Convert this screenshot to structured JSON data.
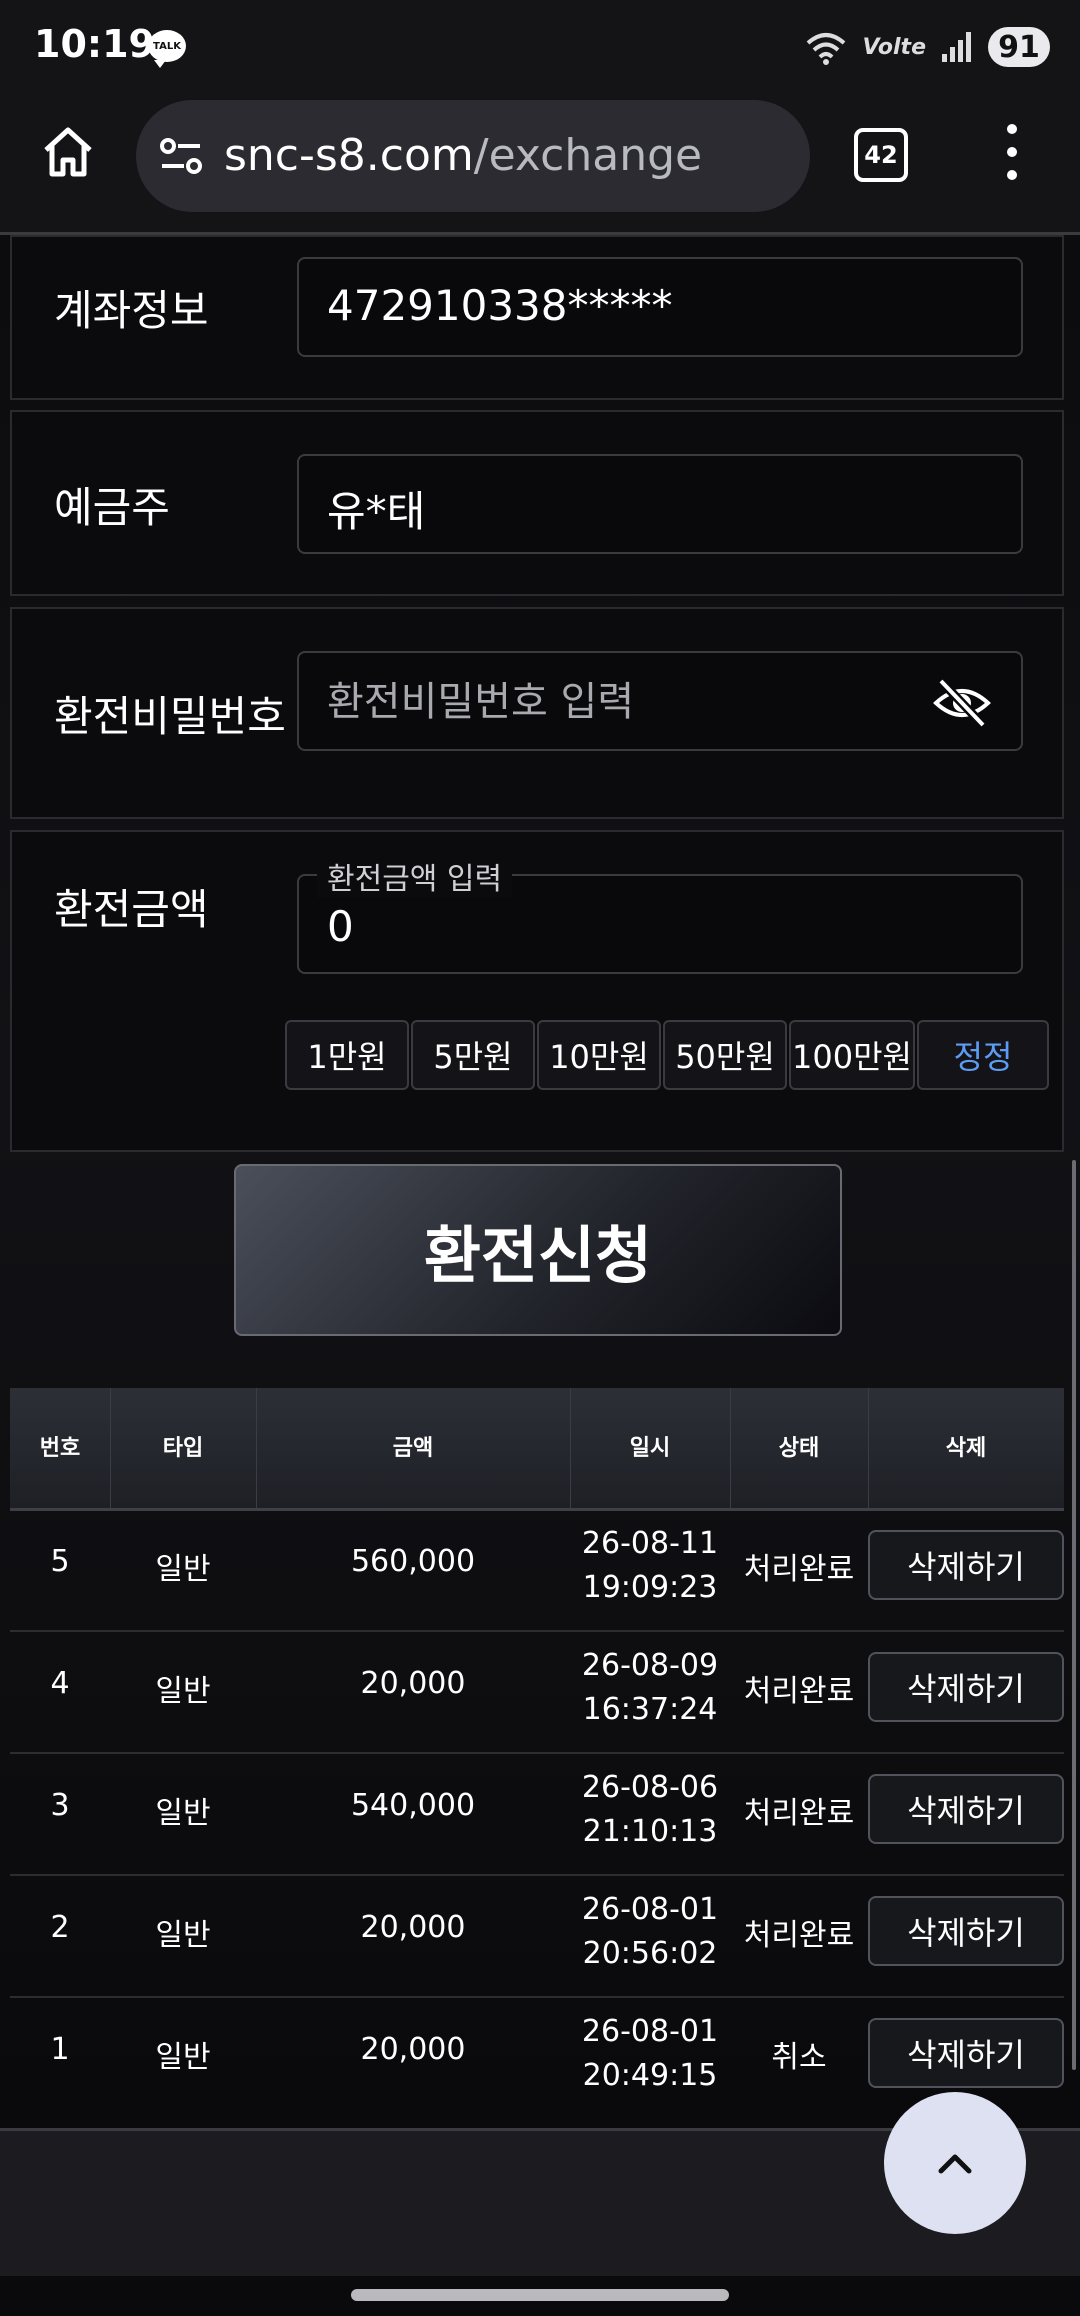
{
  "status_bar": {
    "time": "10:19",
    "talk_badge": "TALK",
    "network": "Volte",
    "battery": "91"
  },
  "browser": {
    "url_domain": "snc-s8.com",
    "url_path": "/exchange",
    "tab_count": "42"
  },
  "form": {
    "account": {
      "label": "계좌정보",
      "value": "472910338*****"
    },
    "holder": {
      "label": "예금주",
      "value": "유*태"
    },
    "password": {
      "label": "환전비밀번호",
      "placeholder": "환전비밀번호 입력"
    },
    "amount": {
      "label": "환전금액",
      "floating_label": "환전금액 입력",
      "value": "0"
    },
    "chips": [
      "1만원",
      "5만원",
      "10만원",
      "50만원",
      "100만원"
    ],
    "correct_label": "정정",
    "submit_label": "환전신청"
  },
  "table": {
    "headers": [
      "번호",
      "타입",
      "금액",
      "일시",
      "상태",
      "삭제"
    ],
    "rows": [
      {
        "no": "5",
        "type": "일반",
        "amount": "560,000",
        "date": "26-08-11",
        "time": "19:09:23",
        "status": "처리완료",
        "delete": "삭제하기"
      },
      {
        "no": "4",
        "type": "일반",
        "amount": "20,000",
        "date": "26-08-09",
        "time": "16:37:24",
        "status": "처리완료",
        "delete": "삭제하기"
      },
      {
        "no": "3",
        "type": "일반",
        "amount": "540,000",
        "date": "26-08-06",
        "time": "21:10:13",
        "status": "처리완료",
        "delete": "삭제하기"
      },
      {
        "no": "2",
        "type": "일반",
        "amount": "20,000",
        "date": "26-08-01",
        "time": "20:56:02",
        "status": "처리완료",
        "delete": "삭제하기"
      },
      {
        "no": "1",
        "type": "일반",
        "amount": "20,000",
        "date": "26-08-01",
        "time": "20:49:15",
        "status": "취소",
        "delete": "삭제하기"
      }
    ]
  },
  "icons": {
    "home": "home-icon",
    "tune": "tune-icon",
    "eye": "eye-off-icon",
    "scroll_top": "chevron-up-icon"
  }
}
